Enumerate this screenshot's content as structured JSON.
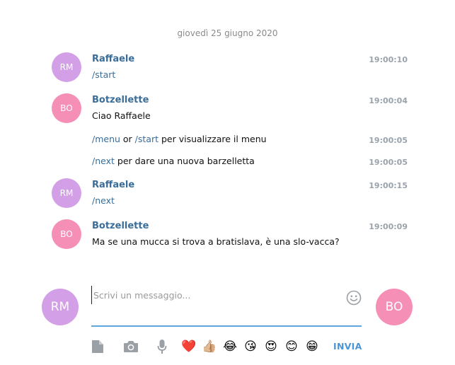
{
  "date_separator": "giovedì 25 giugno 2020",
  "messages": [
    {
      "avatar": "RM",
      "sender": "Raffaele",
      "time": "19:00:10",
      "cmd": "/start"
    },
    {
      "avatar": "BO",
      "sender": "Botzellette",
      "time": "19:00:04",
      "text": "Ciao Raffaele"
    },
    {
      "time": "19:00:05",
      "cmd1": "/menu",
      "mid": " or ",
      "cmd2": "/start",
      "rest": " per visualizzare il menu"
    },
    {
      "time": "19:00:05",
      "cmd": "/next",
      "rest": " per dare una nuova barzelletta"
    },
    {
      "avatar": "RM",
      "sender": "Raffaele",
      "time": "19:00:15",
      "cmd": "/next"
    },
    {
      "avatar": "BO",
      "sender": "Botzellette",
      "time": "19:00:09",
      "text": "Ma se una mucca si trova a bratislava, è una slo-vacca?"
    }
  ],
  "composer": {
    "user_avatar": "RM",
    "peer_avatar": "BO",
    "placeholder": "Scrivi un messaggio...",
    "send_label": "INVIA",
    "emojis": [
      "❤️",
      "👍🏼",
      "😂",
      "😘",
      "😍",
      "😊",
      "😁"
    ]
  },
  "colors": {
    "rm_avatar": "#d39fe6",
    "bo_avatar": "#f58fb6",
    "accent": "#4b95d6",
    "sender": "#3a6d99"
  }
}
